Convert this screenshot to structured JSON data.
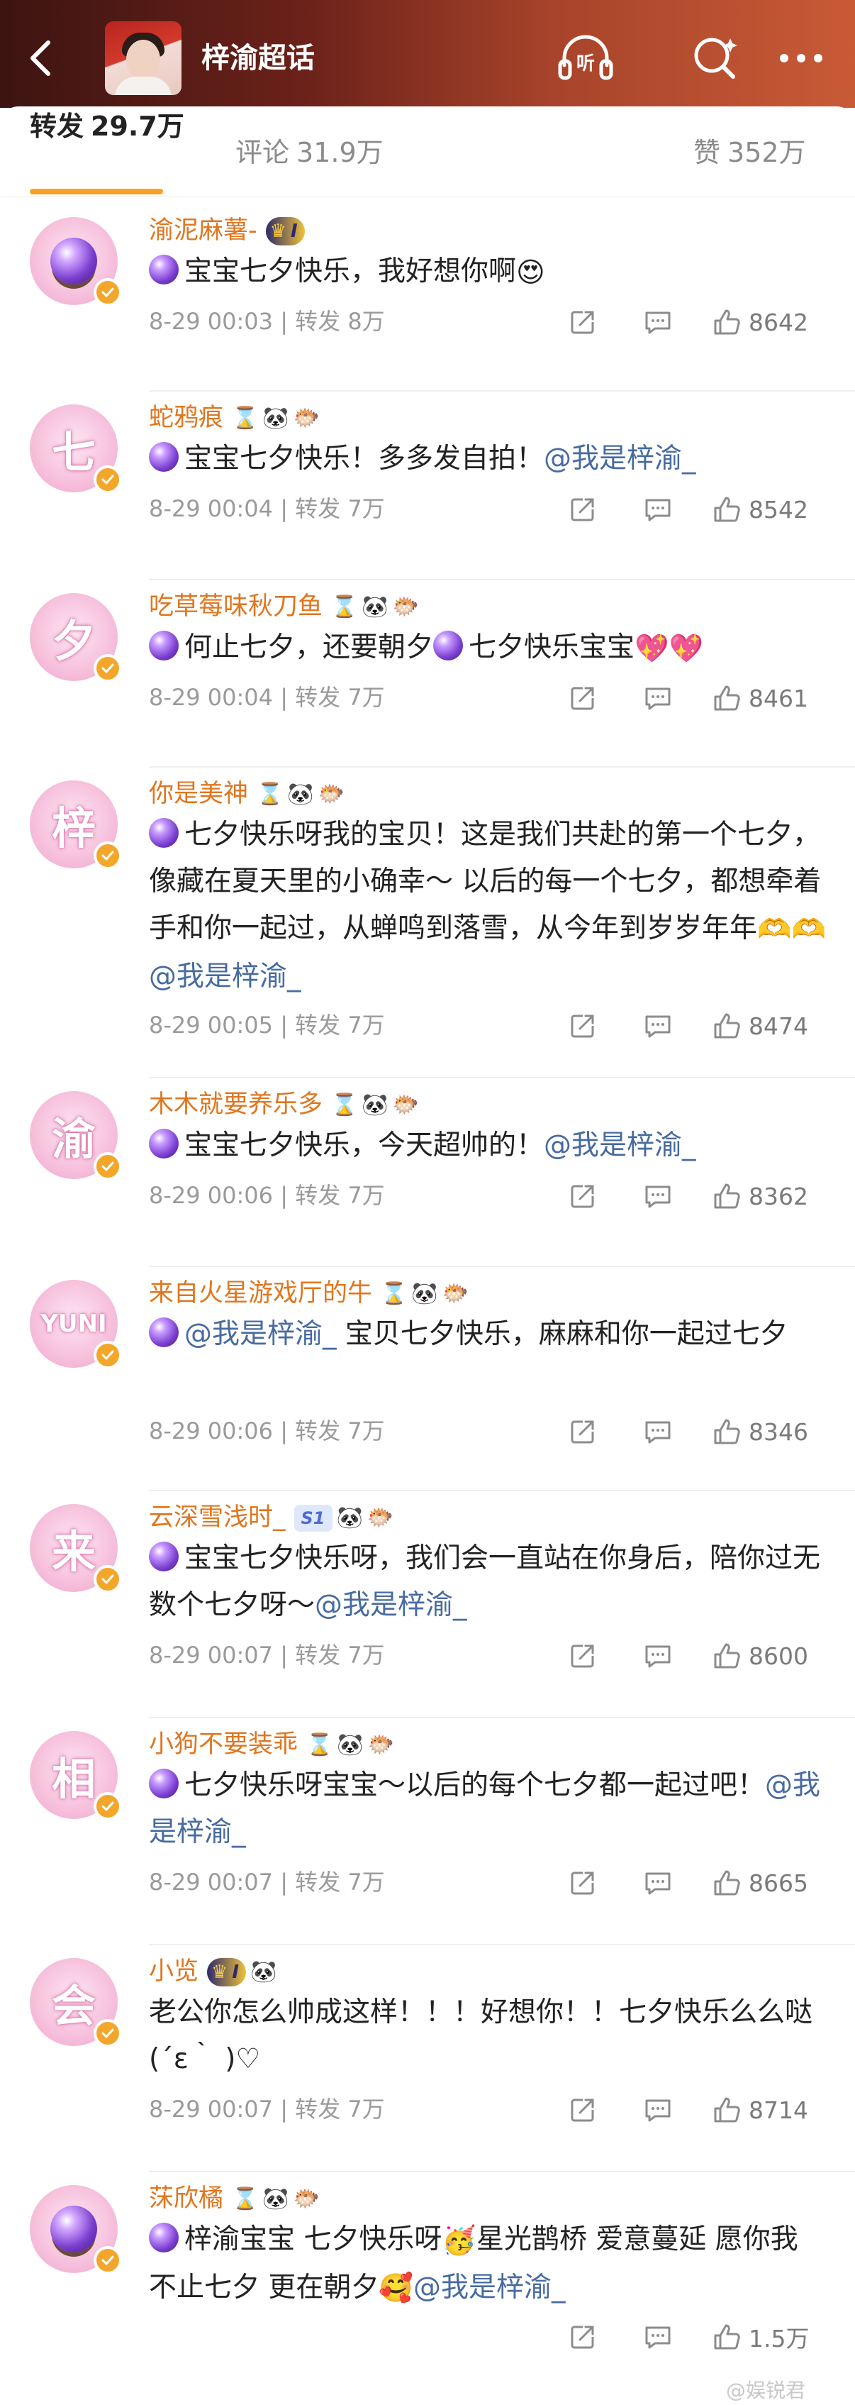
{
  "header": {
    "back_icon": "chevron-left-icon",
    "title": "梓渝超话",
    "listen_icon": "headphones-listen-icon",
    "listen_label": "听",
    "search_icon": "search-icon",
    "more_icon": "more-dots-icon"
  },
  "tabs": [
    {
      "label": "转发",
      "count": "29.7万",
      "active": true
    },
    {
      "label": "评论",
      "count": "31.9万",
      "active": false
    },
    {
      "label": "赞",
      "count": "352万",
      "active": false
    }
  ],
  "colors": {
    "username": "#e0761f",
    "mention": "#476ba1",
    "accent": "#f7a224",
    "meta": "#9a9a9a"
  },
  "comments": [
    {
      "avatar_char": "",
      "avatar_kind": "crystal-ball",
      "user": "渝泥麻薯-",
      "badges": [
        "crown-I"
      ],
      "crown_level": "I",
      "text_parts": [
        {
          "t": "宝宝七夕快乐，我好想你啊"
        },
        {
          "e": "😍"
        }
      ],
      "time": "8-29 00:03",
      "repost": "转发 8万",
      "likes": "8642"
    },
    {
      "avatar_char": "七",
      "user": "蛇鸦痕",
      "badges": [
        "hourglass",
        "panda",
        "fish"
      ],
      "text_parts": [
        {
          "t": "宝宝七夕快乐！多多发自拍！"
        },
        {
          "m": "@我是梓渝_"
        }
      ],
      "time": "8-29 00:04",
      "repost": "转发 7万",
      "likes": "8542"
    },
    {
      "avatar_char": "夕",
      "user": "吃草莓味秋刀鱼",
      "badges": [
        "hourglass",
        "panda",
        "fish"
      ],
      "text_parts": [
        {
          "t": "何止七夕，还要朝夕"
        },
        {
          "o": 1
        },
        {
          "t": "七夕快乐宝宝"
        },
        {
          "e": "💖💖"
        }
      ],
      "time": "8-29 00:04",
      "repost": "转发 7万",
      "likes": "8461"
    },
    {
      "avatar_char": "梓",
      "user": "你是美神",
      "badges": [
        "hourglass",
        "panda",
        "fish"
      ],
      "text_parts": [
        {
          "t": "七夕快乐呀我的宝贝！这是我们共赴的第一个七夕，像藏在夏天里的小确幸～ 以后的每一个七夕，都想牵着手和你一起过，从蝉鸣到落雪，从今年到岁岁年年"
        },
        {
          "e": "🫶🫶"
        },
        {
          "m": "@我是梓渝_"
        }
      ],
      "time": "8-29 00:05",
      "repost": "转发 7万",
      "likes": "8474"
    },
    {
      "avatar_char": "渝",
      "user": "木木就要养乐多",
      "badges": [
        "hourglass",
        "panda",
        "fish"
      ],
      "text_parts": [
        {
          "t": "宝宝七夕快乐，今天超帅的！"
        },
        {
          "m": "@我是梓渝_"
        }
      ],
      "time": "8-29 00:06",
      "repost": "转发 7万",
      "likes": "8362"
    },
    {
      "avatar_char": "YUNI",
      "user": "来自火星游戏厅的牛",
      "badges": [
        "hourglass",
        "panda",
        "fish"
      ],
      "text_parts": [
        {
          "m": "@我是梓渝_"
        },
        {
          "t": " 宝贝七夕快乐，麻麻和你一起过七夕"
        }
      ],
      "time": "8-29 00:06",
      "repost": "转发 7万",
      "likes": "8346"
    },
    {
      "avatar_char": "来",
      "user": "云深雪浅时_",
      "badges": [
        "s1",
        "panda",
        "fish"
      ],
      "s1_label": "S1",
      "text_parts": [
        {
          "t": "宝宝七夕快乐呀，我们会一直站在你身后，陪你过无数个七夕呀～"
        },
        {
          "m": "@我是梓渝_"
        }
      ],
      "time": "8-29 00:07",
      "repost": "转发 7万",
      "likes": "8600"
    },
    {
      "avatar_char": "相",
      "user": "小狗不要装乖",
      "badges": [
        "hourglass",
        "panda",
        "fish"
      ],
      "text_parts": [
        {
          "t": "七夕快乐呀宝宝～以后的每个七夕都一起过吧！"
        },
        {
          "m": "@我是梓渝_"
        }
      ],
      "time": "8-29 00:07",
      "repost": "转发 7万",
      "likes": "8665"
    },
    {
      "avatar_char": "会",
      "user": "小览",
      "badges": [
        "crown-I",
        "panda"
      ],
      "crown_level": "I",
      "text_parts": [
        {
          "t": "老公你怎么帅成这样！！！好想你！！七夕快乐么么哒(´ε｀ )♡"
        }
      ],
      "no_orb": true,
      "time": "8-29 00:07",
      "repost": "转发 7万",
      "likes": "8714"
    },
    {
      "avatar_char": "",
      "avatar_kind": "crystal-ball",
      "user": "莯欣橘",
      "badges": [
        "hourglass",
        "panda",
        "fish"
      ],
      "text_parts": [
        {
          "t": "梓渝宝宝 七夕快乐呀"
        },
        {
          "e": "🥳"
        },
        {
          "t": "星光鹊桥 爱意蔓延 愿你我 不止七夕 更在朝夕"
        },
        {
          "e": "🥰"
        },
        {
          "m": "@我是梓渝_"
        }
      ],
      "time": "",
      "repost": "",
      "likes": "1.5万"
    }
  ],
  "watermark": "@娱锐君"
}
